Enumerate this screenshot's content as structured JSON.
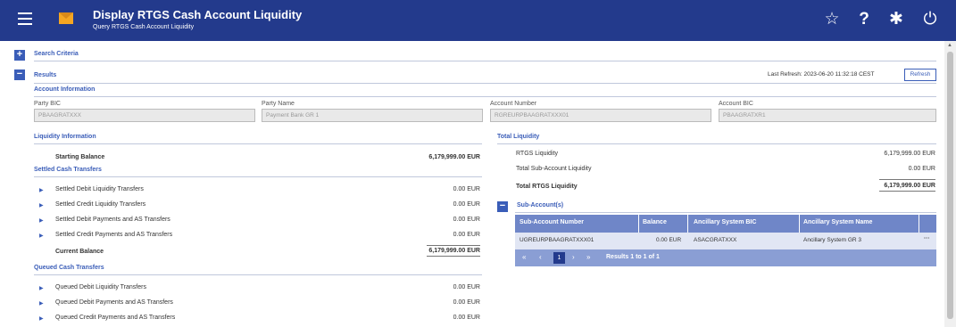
{
  "header": {
    "title": "Display RTGS Cash Account Liquidity",
    "subtitle": "Query RTGS Cash Account Liquidity",
    "icons": [
      "menu-icon",
      "mail-icon",
      "star-icon",
      "help-icon",
      "gear-icon",
      "power-icon"
    ]
  },
  "sections": {
    "search_criteria": "Search Criteria",
    "results": "Results",
    "last_refresh": "Last Refresh: 2023-06-20 11:32:18 CEST",
    "refresh_button": "Refresh"
  },
  "account_info": {
    "heading": "Account Information",
    "party_bic_label": "Party BIC",
    "party_bic_value": "PBAAGRATXXX",
    "party_name_label": "Party Name",
    "party_name_value": "Payment Bank GR 1",
    "account_number_label": "Account Number",
    "account_number_value": "RGREURPBAAGRATXXX01",
    "account_bic_label": "Account BIC",
    "account_bic_value": "PBAAGRATXR1"
  },
  "liquidity": {
    "heading": "Liquidity Information",
    "starting_balance_label": "Starting Balance",
    "starting_balance_value": "6,179,999.00 EUR",
    "settled_heading": "Settled Cash Transfers",
    "settled": [
      {
        "label": "Settled Debit Liquidity Transfers",
        "value": "0.00 EUR"
      },
      {
        "label": "Settled Credit Liquidity Transfers",
        "value": "0.00 EUR"
      },
      {
        "label": "Settled Debit Payments and AS Transfers",
        "value": "0.00 EUR"
      },
      {
        "label": "Settled Credit Payments and AS Transfers",
        "value": "0.00 EUR"
      }
    ],
    "current_balance_label": "Current Balance",
    "current_balance_value": "6,179,999.00 EUR",
    "queued_heading": "Queued Cash Transfers",
    "queued": [
      {
        "label": "Queued Debit Liquidity Transfers",
        "value": "0.00 EUR"
      },
      {
        "label": "Queued Debit Payments and AS Transfers",
        "value": "0.00 EUR"
      },
      {
        "label": "Queued Credit Payments and AS Transfers",
        "value": "0.00 EUR"
      }
    ]
  },
  "total_liquidity": {
    "heading": "Total Liquidity",
    "rtgs_label": "RTGS Liquidity",
    "rtgs_value": "6,179,999.00 EUR",
    "sub_label": "Total Sub-Account Liquidity",
    "sub_value": "0.00 EUR",
    "total_label": "Total RTGS Liquidity",
    "total_value": "6,179,999.00 EUR"
  },
  "sub_accounts": {
    "heading": "Sub-Account(s)",
    "columns": [
      "Sub-Account Number",
      "Balance",
      "Ancillary System BIC",
      "Ancillary System Name"
    ],
    "row": {
      "number": "UGREURPBAAGRATXXX01",
      "balance": "0.00 EUR",
      "as_bic": "ASACGRATXXX",
      "as_name": "Ancillary System GR 3",
      "more": "···"
    },
    "pager": {
      "first": "«",
      "prev": "‹",
      "current": "1",
      "next": "›",
      "last": "»",
      "results": "Results 1 to 1 of 1"
    }
  },
  "colors": {
    "header_bg": "#233a8c",
    "accent": "#3a5db8",
    "table_header": "#6f86c8",
    "table_row": "#e1e6f4"
  }
}
